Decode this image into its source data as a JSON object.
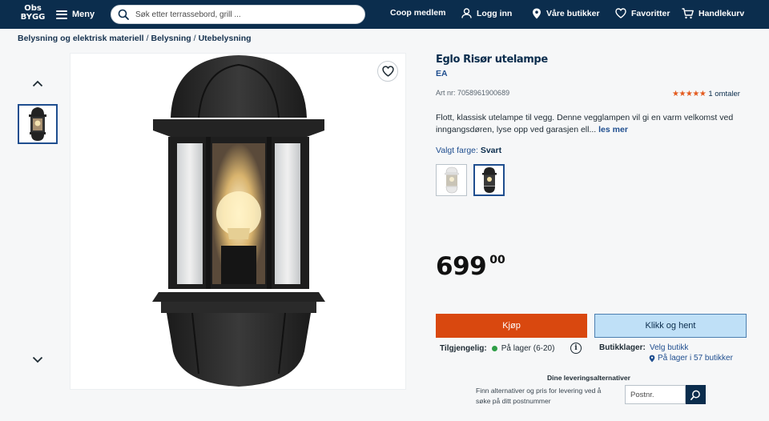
{
  "header": {
    "logo_line1": "Obs",
    "logo_line2": "BYGG",
    "menu_label": "Meny",
    "search_placeholder": "Søk etter terrassebord, grill ...",
    "nav": {
      "member": "Coop medlem",
      "login": "Logg inn",
      "stores": "Våre butikker",
      "favorites": "Favoritter",
      "cart": "Handlekurv"
    }
  },
  "breadcrumb": [
    "Belysning og elektrisk materiell",
    "Belysning",
    "Utebelysning"
  ],
  "product": {
    "title": "Eglo Risør utelampe",
    "brand": "EA",
    "article_number": "Art nr: 7058961900689",
    "rating_stars": 5,
    "reviews": "1 omtaler",
    "description": "Flott, klassisk utelampe til vegg. Denne vegglampen vil gi en varm velkomst ved inngangsdøren, lyse opp ved garasjen ell...",
    "read_more": "les mer",
    "color_label": "Valgt farge:",
    "color_value": "Svart",
    "price_integer": "699",
    "price_decimals": "00",
    "buy_label": "Kjøp",
    "pickup_label": "Klikk og hent",
    "availability_label": "Tilgjengelig:",
    "availability_value": "På lager (6-20)",
    "store_stock_label": "Butikklager:",
    "choose_store": "Velg butikk",
    "store_stock_value": "På lager i 57 butikker",
    "delivery_title": "Dine leveringsalternativer",
    "delivery_text": "Finn alternativer og pris for levering ved å søke på ditt postnummer",
    "postal_placeholder": "Postnr."
  },
  "colors": {
    "header_bg": "#0b2d4d",
    "buy_button": "#d9480f",
    "pickup_button": "#bfe0f7",
    "star_color": "#e35a1e",
    "stock_dot": "#2e9e46",
    "link": "#1f4e8f"
  }
}
